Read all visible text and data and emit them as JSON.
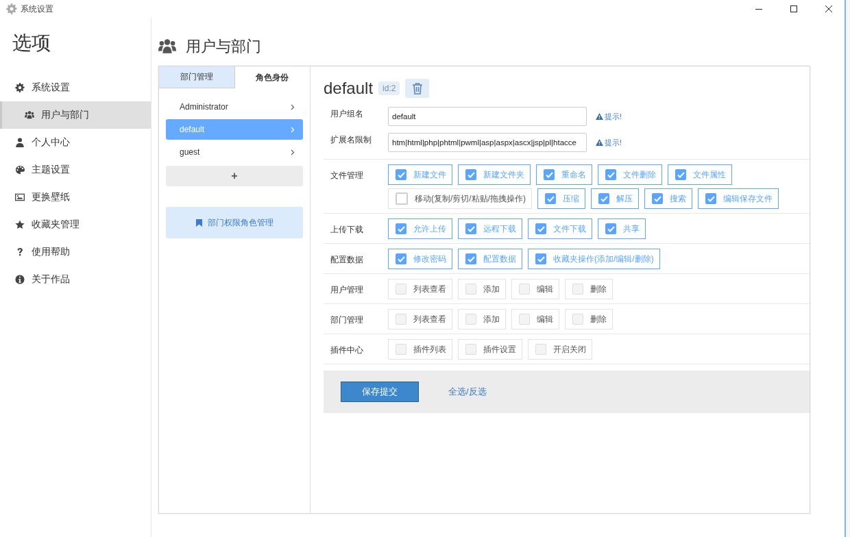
{
  "window": {
    "title": "系统设置"
  },
  "sidebar": {
    "heading": "选项",
    "items": [
      {
        "label": "系统设置",
        "selected": false
      },
      {
        "label": "用户与部门",
        "selected": true
      },
      {
        "label": "个人中心",
        "selected": false
      },
      {
        "label": "主题设置",
        "selected": false
      },
      {
        "label": "更换壁纸",
        "selected": false
      },
      {
        "label": "收藏夹管理",
        "selected": false
      },
      {
        "label": "使用帮助",
        "selected": false
      },
      {
        "label": "关于作品",
        "selected": false
      }
    ]
  },
  "page_title": "用户与部门",
  "tabs": [
    {
      "label": "部门管理",
      "selected": false
    },
    {
      "label": "角色身份",
      "selected": true
    }
  ],
  "roles": [
    {
      "name": "Administrator",
      "selected": false
    },
    {
      "name": "default",
      "selected": true
    },
    {
      "name": "guest",
      "selected": false
    }
  ],
  "add_button": "+",
  "role_permission_link": "部门权限角色管理",
  "role": {
    "name": "default",
    "id": "id:2"
  },
  "fields": [
    {
      "label": "用户组名",
      "value": "default",
      "hint": "提示!"
    },
    {
      "label": "扩展名限制",
      "value": "htm|html|php|phtml|pwml|asp|aspx|ascx|jsp|pl|htacce",
      "hint": "提示!"
    }
  ],
  "groups": [
    {
      "label": "文件管理",
      "options": [
        {
          "label": "新建文件",
          "checked": true
        },
        {
          "label": "新建文件夹",
          "checked": true
        },
        {
          "label": "重命名",
          "checked": true
        },
        {
          "label": "文件删除",
          "checked": true
        },
        {
          "label": "文件属性",
          "checked": true
        },
        {
          "label": "移动(复制/剪切/粘贴/拖拽操作)",
          "checked": false
        },
        {
          "label": "压缩",
          "checked": true
        },
        {
          "label": "解压",
          "checked": true
        },
        {
          "label": "搜索",
          "checked": true
        },
        {
          "label": "编辑保存文件",
          "checked": true
        }
      ]
    },
    {
      "label": "上传下载",
      "options": [
        {
          "label": "允许上传",
          "checked": true
        },
        {
          "label": "远程下载",
          "checked": true
        },
        {
          "label": "文件下载",
          "checked": true
        },
        {
          "label": "共享",
          "checked": true
        }
      ]
    },
    {
      "label": "配置数据",
      "options": [
        {
          "label": "修改密码",
          "checked": true
        },
        {
          "label": "配置数据",
          "checked": true
        },
        {
          "label": "收藏夹操作(添加/编辑/删除)",
          "checked": true
        }
      ]
    },
    {
      "label": "用户管理",
      "options": [
        {
          "label": "列表查看",
          "checked": false
        },
        {
          "label": "添加",
          "checked": false
        },
        {
          "label": "编辑",
          "checked": false
        },
        {
          "label": "删除",
          "checked": false
        }
      ]
    },
    {
      "label": "部门管理",
      "options": [
        {
          "label": "列表查看",
          "checked": false
        },
        {
          "label": "添加",
          "checked": false
        },
        {
          "label": "编辑",
          "checked": false
        },
        {
          "label": "删除",
          "checked": false
        }
      ]
    },
    {
      "label": "插件中心",
      "options": [
        {
          "label": "插件列表",
          "checked": false
        },
        {
          "label": "插件设置",
          "checked": false
        },
        {
          "label": "开启关闭",
          "checked": false
        }
      ]
    }
  ],
  "footer": {
    "submit": "保存提交",
    "toggle_all": "全选/反选"
  }
}
